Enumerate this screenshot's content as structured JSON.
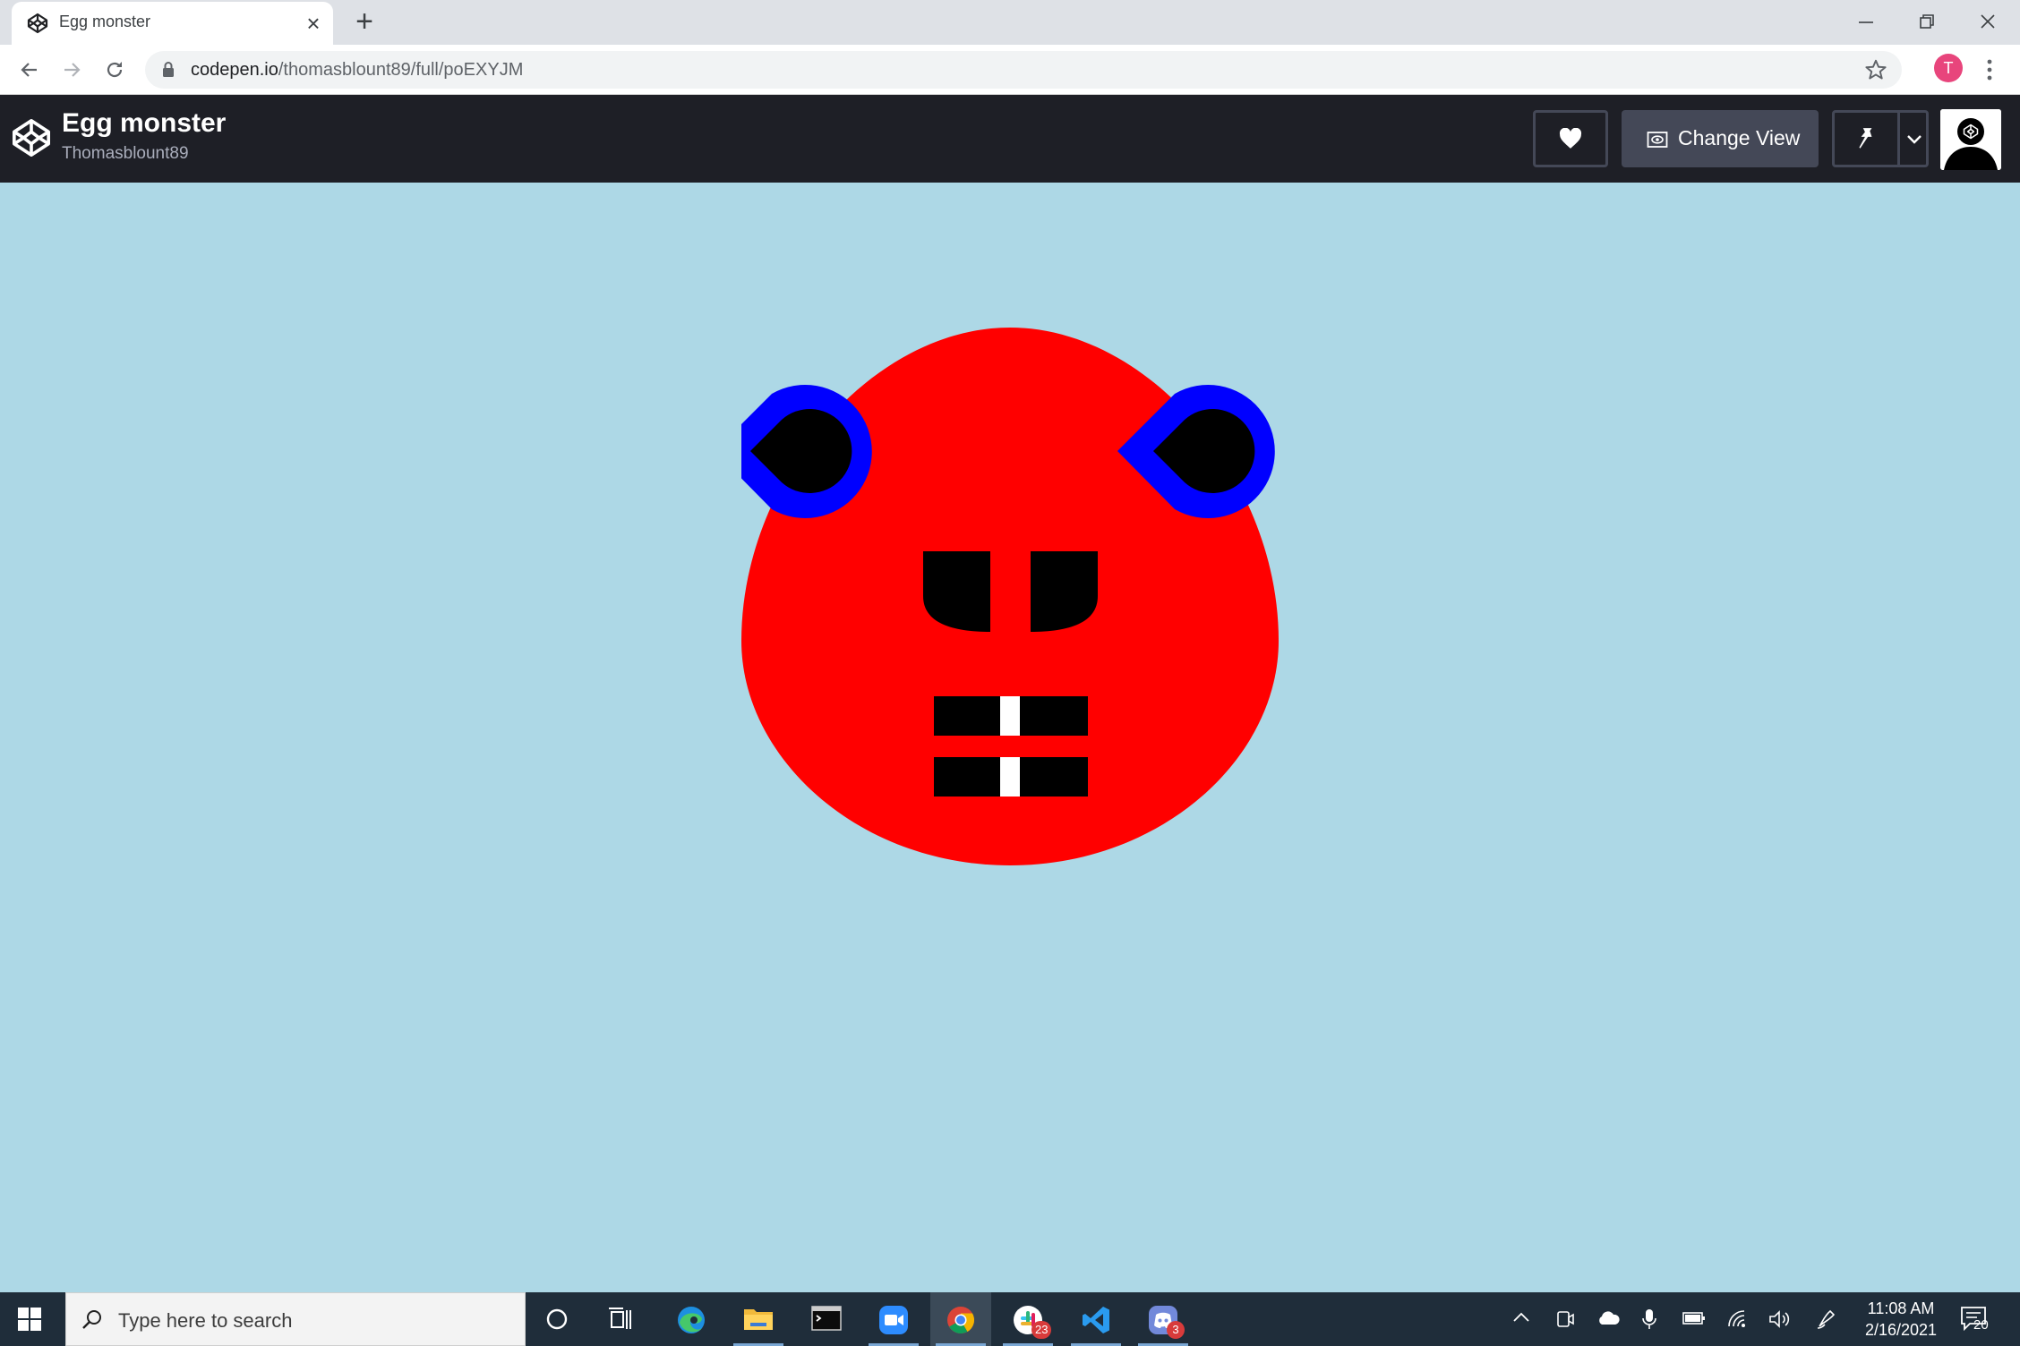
{
  "browser": {
    "tab_title": "Egg monster",
    "url_domain": "codepen.io",
    "url_path": "/thomasblount89/full/poEXYJM",
    "profile_initial": "T"
  },
  "codepen": {
    "pen_title": "Egg monster",
    "author": "Thomasblount89",
    "change_view_label": "Change View"
  },
  "egg_monster": {
    "colors": {
      "background": "#add8e6",
      "body": "#ff0000",
      "ear_ring": "#0000ff",
      "features": "#000000",
      "teeth": "#ffffff"
    }
  },
  "taskbar": {
    "search_placeholder": "Type here to search",
    "slack_badge": "23",
    "discord_badge": "3",
    "time": "11:08 AM",
    "date": "2/16/2021",
    "notification_count": "20"
  }
}
